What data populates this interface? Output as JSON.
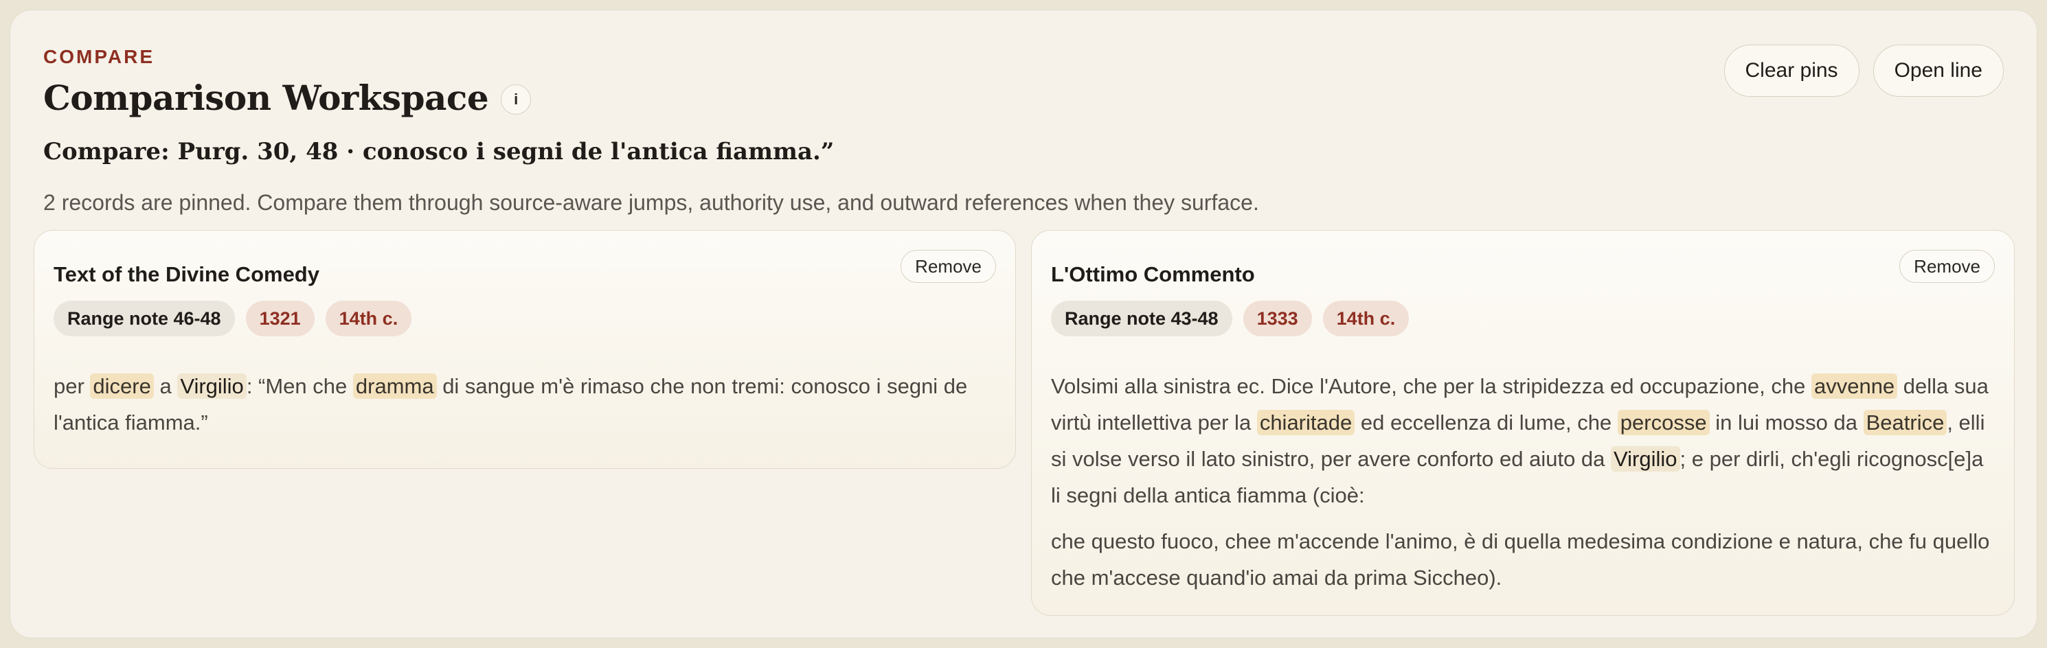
{
  "header": {
    "eyebrow": "COMPARE",
    "title": "Comparison Workspace",
    "info_label": "i",
    "compare_line": "Compare: Purg. 30, 48 · conosco i segni de l'antica fiamma.”",
    "summary": "2 records are pinned. Compare them through source-aware jumps, authority use, and outward references when they surface."
  },
  "actions": {
    "clear_pins": "Clear pins",
    "open_line": "Open line"
  },
  "colors": {
    "accent": "#8e2f22",
    "highlight": "#f3e2bd",
    "panel": "#f6f2e9"
  },
  "cards": [
    {
      "title": "Text of the Divine Comedy",
      "remove_label": "Remove",
      "chips": [
        "Range note 46-48",
        "1321",
        "14th c."
      ],
      "body": {
        "s1": "per ",
        "h1": "dicere",
        "s2": " a ",
        "h2": "Virgilio",
        "s3": ": “Men che ",
        "h3": "dramma",
        "s4": " di sangue m'è rimaso che non tremi: conosco i segni de l'antica fiamma.”"
      }
    },
    {
      "title": "L'Ottimo Commento",
      "remove_label": "Remove",
      "chips": [
        "Range note 43-48",
        "1333",
        "14th c."
      ],
      "body": {
        "s1": "Volsimi alla sinistra ec. Dice l'Autore, che per la stripidezza ed occupazione, che ",
        "h1": "avvenne",
        "s2": " della sua virtù intellettiva per la ",
        "h2": "chiaritade",
        "s3": " ed eccellenza di lume, che ",
        "h3": "percosse",
        "s4": " in lui mosso da ",
        "h4": "Beatrice",
        "s5": ", elli si volse verso il lato sinistro, per avere conforto ed aiuto da ",
        "h5": "Virgilio",
        "s6": "; e per dirli, ch'egli ricognosc[e]a li segni della antica fiamma (cioè:",
        "p2": "che questo fuoco, chee m'accende l'animo, è di quella medesima condizione e natura, che fu quello che m'accese quand'io amai da prima Siccheo)."
      }
    }
  ]
}
